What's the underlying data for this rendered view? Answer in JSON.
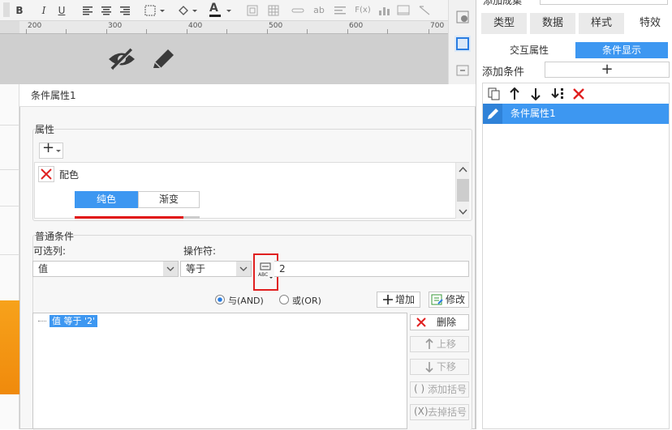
{
  "toolbar": {
    "bold": "B",
    "italic": "I",
    "underline": "U",
    "text_size": "ab",
    "formula": "F(x)",
    "font_color_letter": "A"
  },
  "ruler": {
    "ticks": [
      "200",
      "300",
      "400",
      "500",
      "600",
      "700"
    ]
  },
  "right_panel": {
    "top_partial_label": "添加成集",
    "tabs": [
      "类型",
      "数据",
      "样式",
      "特效"
    ],
    "subtabs": [
      "交互属性",
      "条件显示"
    ],
    "add_condition_label": "添加条件",
    "add_condition_plus": "+",
    "list_items": [
      "条件属性1"
    ]
  },
  "dialog": {
    "title": "条件属性1",
    "attribute_group": "属性",
    "add_symbol": "+",
    "attribute_item": "配色",
    "color_tabs": [
      "纯色",
      "渐变"
    ],
    "condition_group": "普通条件",
    "column_label": "可选列:",
    "column_value": "值",
    "operator_label": "操作符:",
    "operator_value": "等于",
    "value_input": "2",
    "and_label": "与(AND)",
    "or_label": "或(OR)",
    "add_button": "增加",
    "modify_button": "修改",
    "condition_expr": "值 等于 '2'",
    "side_buttons": {
      "delete": "删除",
      "up": "上移",
      "down": "下移",
      "add_bracket": "添加括号",
      "remove_bracket": "去掉括号"
    }
  }
}
